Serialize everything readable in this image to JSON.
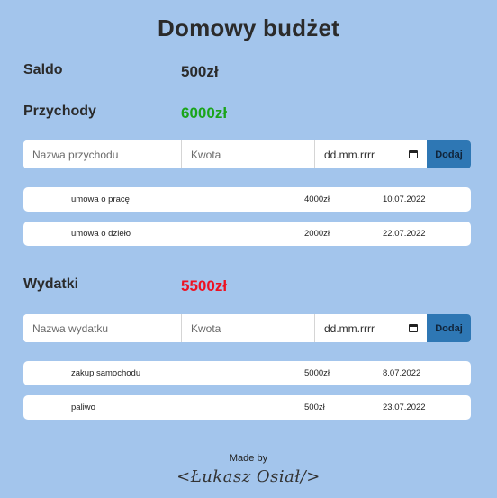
{
  "header": {
    "title": "Domowy budżet"
  },
  "balance": {
    "label": "Saldo",
    "value": "500zł"
  },
  "income": {
    "label": "Przychody",
    "total": "6000zł",
    "total_color": "#1aa51a",
    "form": {
      "name_placeholder": "Nazwa przychodu",
      "amount_placeholder": "Kwota",
      "date_placeholder": "dd.mm.rrrr",
      "date_icon": "calendar-icon",
      "add_label": "Dodaj"
    },
    "entries": [
      {
        "name": "umowa o pracę",
        "amount": "4000zł",
        "date": "10.07.2022"
      },
      {
        "name": "umowa o dzieło",
        "amount": "2000zł",
        "date": "22.07.2022"
      }
    ]
  },
  "expenses": {
    "label": "Wydatki",
    "total": "5500zł",
    "total_color": "#ee1122",
    "form": {
      "name_placeholder": "Nazwa wydatku",
      "amount_placeholder": "Kwota",
      "date_placeholder": "dd.mm.rrrr",
      "date_icon": "calendar-icon",
      "add_label": "Dodaj"
    },
    "entries": [
      {
        "name": "zakup samochodu",
        "amount": "5000zł",
        "date": "8.07.2022"
      },
      {
        "name": "paliwo",
        "amount": "500zł",
        "date": "23.07.2022"
      }
    ]
  },
  "footer": {
    "made_by": "Made by",
    "signature": "<Łukasz Osiał/>"
  },
  "colors": {
    "background": "#a3c5ec",
    "button": "#2e77b4"
  }
}
